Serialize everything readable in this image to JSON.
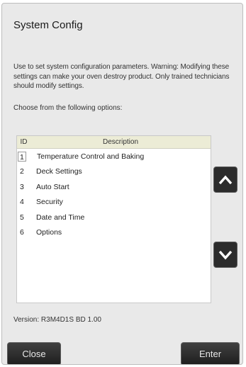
{
  "dialog": {
    "title": "System Config",
    "description": "Use to set system configuration parameters. Warning: Modifying these settings can make your oven destroy product. Only trained technicians should modify settings.",
    "prompt": "Choose from the following options:"
  },
  "list": {
    "headers": {
      "id": "ID",
      "description": "Description"
    },
    "items": [
      {
        "id": "1",
        "label": "Temperature Control and Baking"
      },
      {
        "id": "2",
        "label": "Deck Settings"
      },
      {
        "id": "3",
        "label": "Auto Start"
      },
      {
        "id": "4",
        "label": "Security"
      },
      {
        "id": "5",
        "label": "Date and Time"
      },
      {
        "id": "6",
        "label": "Options"
      }
    ],
    "selected_index": 0
  },
  "scroll": {
    "up_icon": "chevron-up-icon",
    "down_icon": "chevron-down-icon"
  },
  "footer": {
    "version": "Version: R3M4D1S BD 1.00",
    "close_label": "Close",
    "enter_label": "Enter"
  },
  "colors": {
    "background": "#e9e9e9",
    "header_bg": "#ececd6",
    "button_bg": "#2c2c2c",
    "button_text": "#e8e8e8"
  }
}
